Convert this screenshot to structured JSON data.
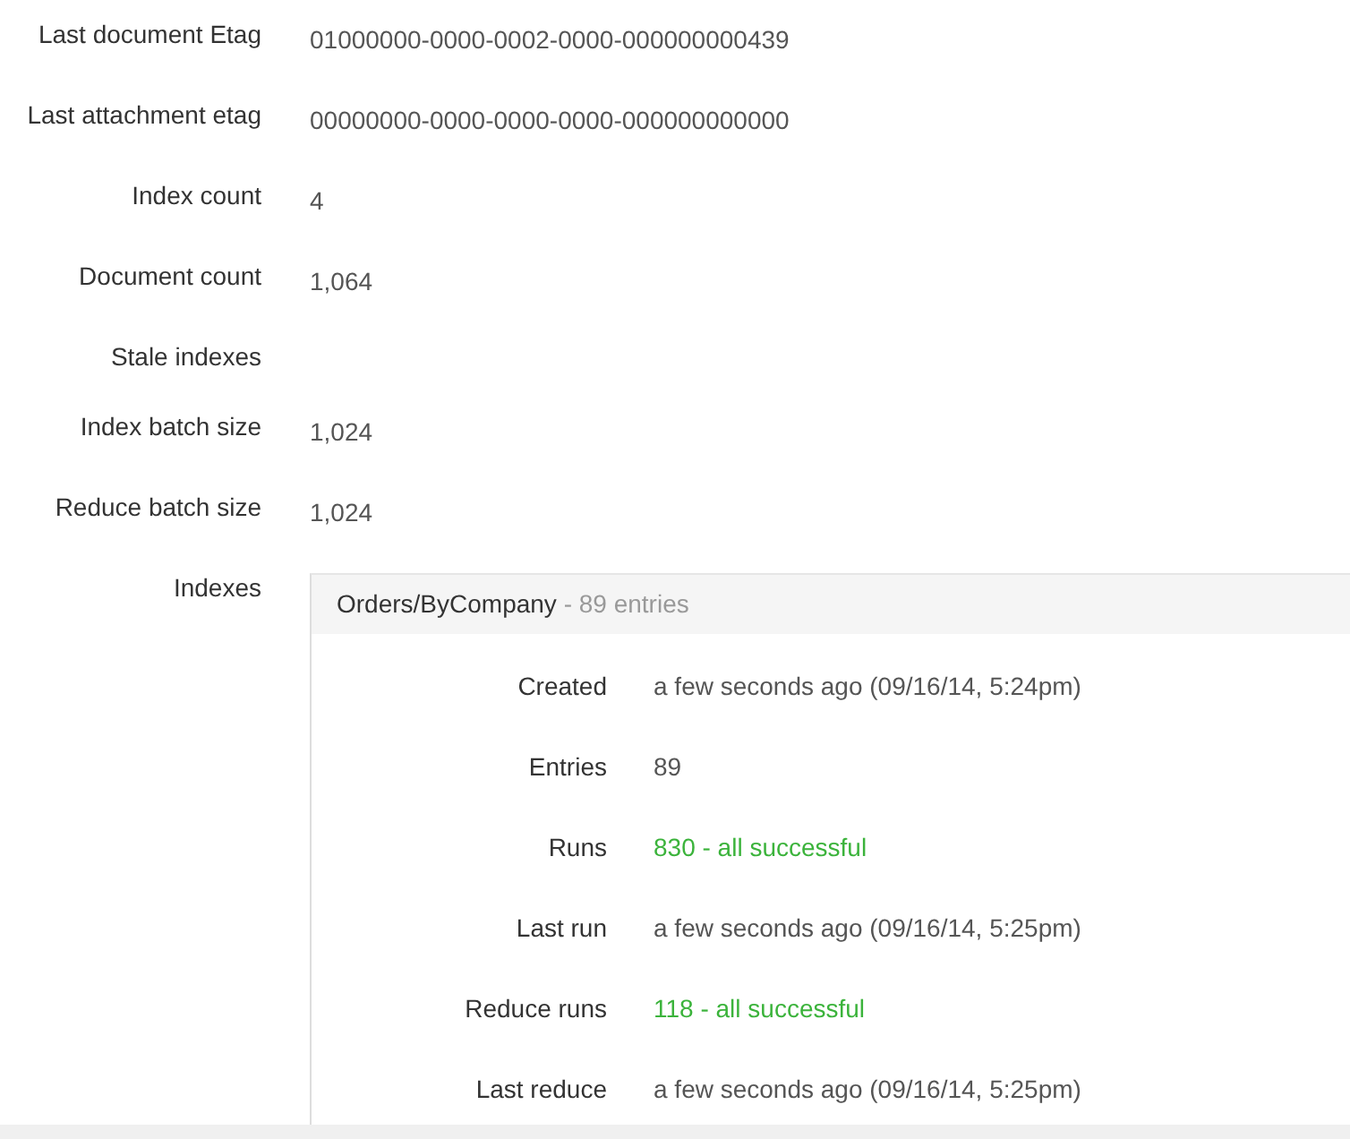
{
  "stats": [
    {
      "label": "Last document Etag",
      "value": "01000000-0000-0002-0000-000000000439"
    },
    {
      "label": "Last attachment etag",
      "value": "00000000-0000-0000-0000-000000000000"
    },
    {
      "label": "Index count",
      "value": "4"
    },
    {
      "label": "Document count",
      "value": "1,064"
    },
    {
      "label": "Stale indexes"
    },
    {
      "label": "Index batch size",
      "value": "1,024"
    },
    {
      "label": "Reduce batch size",
      "value": "1,024"
    }
  ],
  "indexes": {
    "label": "Indexes",
    "items": [
      {
        "name": "Orders/ByCompany",
        "count": "- 89 entries",
        "details": [
          {
            "label": "Created",
            "value": "a few seconds ago (09/16/14, 5:24pm)",
            "kind": "plain"
          },
          {
            "label": "Entries",
            "value": "89",
            "kind": "plain"
          },
          {
            "label": "Runs",
            "value": "830 - all successful",
            "kind": "success"
          },
          {
            "label": "Last run",
            "value": "a few seconds ago (09/16/14, 5:25pm)",
            "kind": "plain"
          },
          {
            "label": "Reduce runs",
            "value": "118 - all successful",
            "kind": "success"
          },
          {
            "label": "Last reduce",
            "value": "a few seconds ago (09/16/14, 5:25pm)",
            "kind": "plain"
          }
        ]
      }
    ]
  }
}
